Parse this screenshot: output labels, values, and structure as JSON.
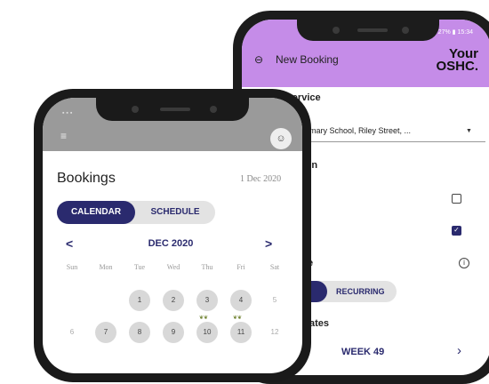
{
  "back_phone": {
    "title": "New Booking",
    "logo": [
      "Your",
      "OSHC."
    ],
    "status_right": "27% ▮ 15:34",
    "back_icon": "back-arrow-icon",
    "select_service_label": "Select Service",
    "service_field": {
      "caption": "ation",
      "value": "uth Primary School, Riley Street, ..."
    },
    "children_label": "ren",
    "children_checks": [
      {
        "checked": false
      },
      {
        "checked": true,
        "mark": "✓"
      }
    ],
    "type_label": "e",
    "recurring_label": "RECURRING",
    "dates_label": "ates",
    "week_label": "WEEK 49",
    "chevron": "›",
    "info_glyph": "i"
  },
  "front_phone": {
    "menu_glyph": "≡",
    "title": "Bookings",
    "date": "1 Dec 2020",
    "tabs": [
      "CALENDAR",
      "SCHEDULE"
    ],
    "month": "DEC 2020",
    "prev": "<",
    "next": ">",
    "weekdays": [
      "Sun",
      "Mon",
      "Tue",
      "Wed",
      "Thu",
      "Fri",
      "Sat"
    ],
    "weeks": [
      [
        {
          "d": "",
          "s": "plain"
        },
        {
          "d": "",
          "s": "plain"
        },
        {
          "d": "1",
          "s": "active"
        },
        {
          "d": "2",
          "s": "active"
        },
        {
          "d": "3",
          "s": "active"
        },
        {
          "d": "4",
          "s": "active"
        },
        {
          "d": "5",
          "s": "plain"
        }
      ],
      [
        {
          "d": "6",
          "s": "plain"
        },
        {
          "d": "7",
          "s": "active"
        },
        {
          "d": "8",
          "s": "active"
        },
        {
          "d": "9",
          "s": "active"
        },
        {
          "d": "10",
          "s": "active",
          "mark": "❦❦"
        },
        {
          "d": "11",
          "s": "active",
          "mark": "❦❦"
        },
        {
          "d": "12",
          "s": "plain"
        }
      ]
    ]
  },
  "colors": {
    "accent": "#c58ce8",
    "navy": "#2a2a6e"
  }
}
